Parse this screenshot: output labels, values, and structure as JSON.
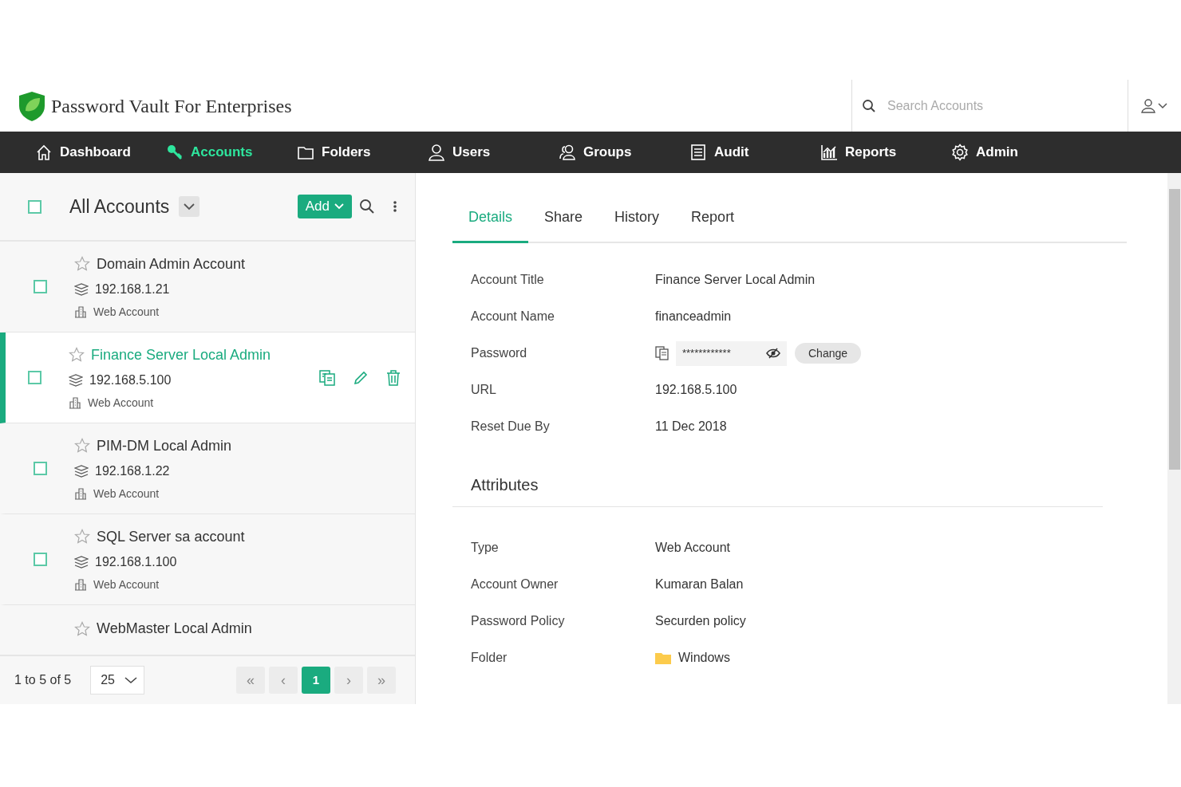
{
  "app": {
    "title": "Password Vault For Enterprises",
    "search": {
      "placeholder": "Search Accounts"
    }
  },
  "nav": [
    {
      "label": "Dashboard",
      "kind": "home",
      "selected": false
    },
    {
      "label": "Accounts",
      "kind": "key",
      "selected": true
    },
    {
      "label": "Folders",
      "kind": "folder",
      "selected": false
    },
    {
      "label": "Users",
      "kind": "user",
      "selected": false
    },
    {
      "label": "Groups",
      "kind": "group",
      "selected": false
    },
    {
      "label": "Audit",
      "kind": "doc",
      "selected": false
    },
    {
      "label": "Reports",
      "kind": "chart",
      "selected": false
    },
    {
      "label": "Admin",
      "kind": "gear",
      "selected": false
    }
  ],
  "list": {
    "title": "All Accounts",
    "checked": false,
    "add_button": "Add",
    "items": [
      {
        "name": "Domain Admin Account",
        "ip": "192.168.1.21",
        "type": "Web Account",
        "checked": false,
        "starred": false,
        "selected": false
      },
      {
        "name": "Finance Server Local Admin",
        "ip": "192.168.5.100",
        "type": "Web Account",
        "checked": false,
        "starred": false,
        "selected": true
      },
      {
        "name": "PIM-DM Local Admin",
        "ip": "192.168.1.22",
        "type": "Web Account",
        "checked": false,
        "starred": false,
        "selected": false
      },
      {
        "name": "SQL Server sa account",
        "ip": "192.168.1.100",
        "type": "Web Account",
        "checked": false,
        "starred": false,
        "selected": false
      },
      {
        "name": "WebMaster Local Admin",
        "starred": false,
        "selected": false
      }
    ],
    "range": "1 to 5 of 5",
    "page_size": "25",
    "pages": [
      {
        "label": "«",
        "disabled": true,
        "selected": false
      },
      {
        "label": "‹",
        "disabled": true,
        "selected": false
      },
      {
        "label": "1",
        "disabled": false,
        "selected": true
      },
      {
        "label": "›",
        "disabled": true,
        "selected": false
      },
      {
        "label": "»",
        "disabled": true,
        "selected": false
      }
    ]
  },
  "tabs": [
    {
      "label": "Details",
      "selected": true
    },
    {
      "label": "Share",
      "selected": false
    },
    {
      "label": "History",
      "selected": false
    },
    {
      "label": "Report",
      "selected": false
    }
  ],
  "details": [
    {
      "label": "Account Title",
      "value": "Finance Server Local Admin",
      "kind": "text"
    },
    {
      "label": "Account Name",
      "value": "financeadmin",
      "kind": "text"
    },
    {
      "label": "Password",
      "value": "************",
      "kind": "password",
      "button": "Change"
    },
    {
      "label": "URL",
      "value": "192.168.5.100",
      "kind": "text"
    },
    {
      "label": "Reset Due By",
      "value": "11 Dec 2018",
      "kind": "text"
    }
  ],
  "attributes_title": "Attributes",
  "attributes": [
    {
      "label": "Type",
      "value": "Web Account",
      "kind": "text"
    },
    {
      "label": "Account Owner",
      "value": "Kumaran Balan",
      "kind": "text"
    },
    {
      "label": "Password Policy",
      "value": "Securden policy",
      "kind": "text"
    },
    {
      "label": "Folder",
      "value": "Windows",
      "kind": "folder"
    }
  ]
}
